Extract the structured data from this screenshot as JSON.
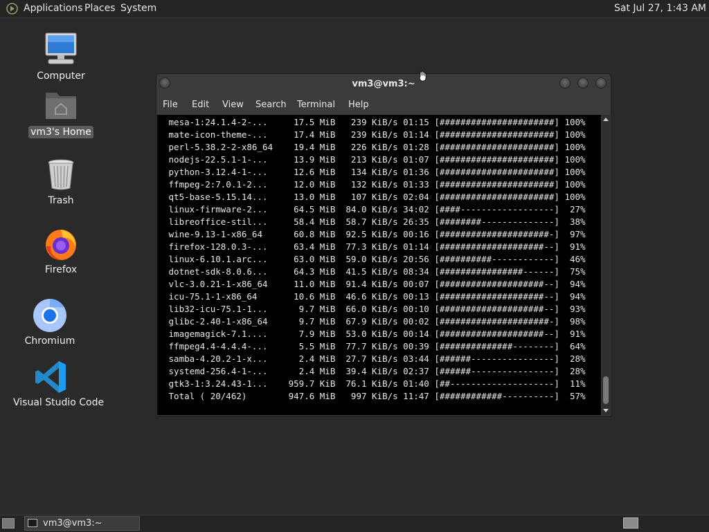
{
  "top_panel": {
    "menus": [
      "Applications",
      "Places",
      "System"
    ],
    "clock": "Sat Jul 27,  1:43 AM"
  },
  "desktop_icons": [
    {
      "label": "Computer",
      "icon": "computer-icon"
    },
    {
      "label": "vm3's Home",
      "icon": "home-folder-icon"
    },
    {
      "label": "Trash",
      "icon": "trash-icon"
    },
    {
      "label": "Firefox",
      "icon": "firefox-icon"
    },
    {
      "label": "Chromium",
      "icon": "chromium-icon"
    },
    {
      "label": "Visual Studio Code",
      "icon": "vscode-icon"
    }
  ],
  "window": {
    "title": "vm3@vm3:~",
    "menu": [
      "File",
      "Edit",
      "View",
      "Search",
      "Terminal",
      "Help"
    ]
  },
  "terminal": {
    "lines": [
      " mesa-1:24.1.4-2-...     17.5 MiB   239 KiB/s 01:15 [######################] 100%",
      " mate-icon-theme-...     17.4 MiB   239 KiB/s 01:14 [######################] 100%",
      " perl-5.38.2-2-x86_64    19.4 MiB   226 KiB/s 01:28 [######################] 100%",
      " nodejs-22.5.1-1-...     13.9 MiB   213 KiB/s 01:07 [######################] 100%",
      " python-3.12.4-1-...     12.6 MiB   134 KiB/s 01:36 [######################] 100%",
      " ffmpeg-2:7.0.1-2...     12.0 MiB   132 KiB/s 01:33 [######################] 100%",
      " qt5-base-5.15.14...     13.0 MiB   107 KiB/s 02:04 [######################] 100%",
      " linux-firmware-2...     64.5 MiB  84.0 KiB/s 34:02 [####------------------]  27%",
      " libreoffice-stil...     58.4 MiB  58.7 KiB/s 26:35 [########--------------]  38%",
      " wine-9.13-1-x86_64      60.8 MiB  92.5 KiB/s 00:16 [#####################-]  97%",
      " firefox-128.0.3-...     63.4 MiB  77.3 KiB/s 01:14 [####################--]  91%",
      " linux-6.10.1.arc...     63.0 MiB  59.0 KiB/s 20:56 [##########------------]  46%",
      " dotnet-sdk-8.0.6...     64.3 MiB  41.5 KiB/s 08:34 [################------]  75%",
      " vlc-3.0.21-1-x86_64     11.0 MiB  91.4 KiB/s 00:07 [####################--]  94%",
      " icu-75.1-1-x86_64       10.6 MiB  46.6 KiB/s 00:13 [####################--]  94%",
      " lib32-icu-75.1-1...      9.7 MiB  66.0 KiB/s 00:10 [####################--]  93%",
      " glibc-2.40-1-x86_64      9.7 MiB  67.9 KiB/s 00:02 [#####################-]  98%",
      " imagemagick-7.1....      7.9 MiB  53.0 KiB/s 00:14 [####################--]  91%",
      " ffmpeg4.4-4.4.4-...      5.5 MiB  77.7 KiB/s 00:39 [##############--------]  64%",
      " samba-4.20.2-1-x...      2.4 MiB  27.7 KiB/s 03:44 [######----------------]  28%",
      " systemd-256.4-1-...      2.4 MiB  39.4 KiB/s 02:37 [######----------------]  28%",
      " gtk3-1:3.24.43-1...    959.7 KiB  76.1 KiB/s 01:40 [##--------------------]  11%",
      " Total ( 20/462)        947.6 MiB   997 KiB/s 11:47 [############----------]  57%"
    ]
  },
  "taskbar": {
    "task_label": "vm3@vm3:~"
  }
}
